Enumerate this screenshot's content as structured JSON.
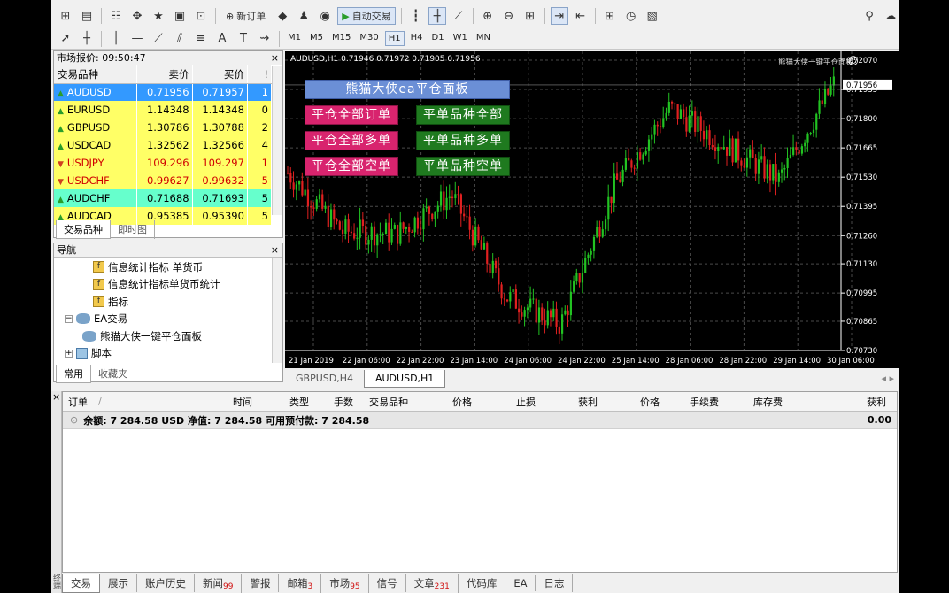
{
  "toolbar": {
    "new_order": "新订单",
    "auto_trading": "自动交易",
    "timeframes": [
      "M1",
      "M5",
      "M15",
      "M30",
      "H1",
      "H4",
      "D1",
      "W1",
      "MN"
    ],
    "active_timeframe": "H1"
  },
  "market_watch": {
    "title": "市场报价: 09:50:47",
    "col_symbol": "交易品种",
    "col_bid": "卖价",
    "col_ask": "买价",
    "col_spread": "!",
    "rows": [
      {
        "symbol": "AUDUSD",
        "bid": "0.71956",
        "ask": "0.71957",
        "spread": "1",
        "bg": "#3399ff",
        "fg": "#ffffff",
        "dir": "up"
      },
      {
        "symbol": "EURUSD",
        "bid": "1.14348",
        "ask": "1.14348",
        "spread": "0",
        "bg": "#ffff66",
        "fg": "#000000",
        "dir": "up"
      },
      {
        "symbol": "GBPUSD",
        "bid": "1.30786",
        "ask": "1.30788",
        "spread": "2",
        "bg": "#ffff66",
        "fg": "#000000",
        "dir": "up"
      },
      {
        "symbol": "USDCAD",
        "bid": "1.32562",
        "ask": "1.32566",
        "spread": "4",
        "bg": "#ffff66",
        "fg": "#000000",
        "dir": "up"
      },
      {
        "symbol": "USDJPY",
        "bid": "109.296",
        "ask": "109.297",
        "spread": "1",
        "bg": "#ffff66",
        "fg": "#d00000",
        "dir": "down"
      },
      {
        "symbol": "USDCHF",
        "bid": "0.99627",
        "ask": "0.99632",
        "spread": "5",
        "bg": "#ffff66",
        "fg": "#d00000",
        "dir": "down"
      },
      {
        "symbol": "AUDCHF",
        "bid": "0.71688",
        "ask": "0.71693",
        "spread": "5",
        "bg": "#66ffcc",
        "fg": "#000000",
        "dir": "up"
      },
      {
        "symbol": "AUDCAD",
        "bid": "0.95385",
        "ask": "0.95390",
        "spread": "5",
        "bg": "#ffff66",
        "fg": "#000000",
        "dir": "up"
      }
    ],
    "tabs": [
      "交易品种",
      "即时图"
    ]
  },
  "navigator": {
    "title": "导航",
    "items": [
      {
        "label": "信息统计指标 单货币",
        "indent": 44,
        "icon": "indicator"
      },
      {
        "label": "信息统计指标单货币统计",
        "indent": 44,
        "icon": "indicator"
      },
      {
        "label": "指标",
        "indent": 44,
        "icon": "indicator"
      },
      {
        "label": "EA交易",
        "indent": 12,
        "icon": "ea",
        "expander": "−"
      },
      {
        "label": "熊猫大侠一键平仓面板",
        "indent": 32,
        "icon": "ea"
      },
      {
        "label": "脚本",
        "indent": 12,
        "icon": "script",
        "expander": "+"
      }
    ],
    "tabs": [
      "常用",
      "收藏夹"
    ]
  },
  "chart": {
    "header": "AUDUSD,H1  0.71946 0.71972 0.71905 0.71956",
    "ea_label": "熊猫大侠一键平仓面板",
    "current_price": "0.71956",
    "price_labels": [
      "0.72070",
      "0.71935",
      "0.71800",
      "0.71665",
      "0.71530",
      "0.71395",
      "0.71260",
      "0.71130",
      "0.70995",
      "0.70865",
      "0.70730"
    ],
    "time_labels": [
      "21 Jan 2019",
      "22 Jan 06:00",
      "22 Jan 22:00",
      "23 Jan 14:00",
      "24 Jan 06:00",
      "24 Jan 22:00",
      "25 Jan 14:00",
      "28 Jan 06:00",
      "28 Jan 22:00",
      "29 Jan 14:00",
      "30 Jan 06:00"
    ],
    "panel_title": "熊猫大侠ea平仓面板",
    "buttons": {
      "close_all": "平仓全部订单",
      "close_buy": "平仓全部多单",
      "close_sell": "平仓全部空单",
      "sym_all": "平单品种全部",
      "sym_buy": "平单品种多单",
      "sym_sell": "平单品种空单"
    },
    "tabs": [
      "GBPUSD,H4",
      "AUDUSD,H1"
    ]
  },
  "terminal": {
    "columns": [
      "订单",
      "时间",
      "类型",
      "手数",
      "交易品种",
      "价格",
      "止损",
      "获利",
      "价格",
      "手续费",
      "库存费",
      "获利"
    ],
    "balance": "余额: 7 284.58 USD  净值: 7 284.58  可用预付款: 7 284.58",
    "profit": "0.00",
    "side_label": "终端",
    "tabs": [
      {
        "label": "交易",
        "badge": ""
      },
      {
        "label": "展示",
        "badge": ""
      },
      {
        "label": "账户历史",
        "badge": ""
      },
      {
        "label": "新闻",
        "badge": "99"
      },
      {
        "label": "警报",
        "badge": ""
      },
      {
        "label": "邮箱",
        "badge": "3"
      },
      {
        "label": "市场",
        "badge": "95"
      },
      {
        "label": "信号",
        "badge": ""
      },
      {
        "label": "文章",
        "badge": "231"
      },
      {
        "label": "代码库",
        "badge": ""
      },
      {
        "label": "EA",
        "badge": ""
      },
      {
        "label": "日志",
        "badge": ""
      }
    ]
  },
  "chart_data": {
    "type": "line",
    "title": "AUDUSD,H1",
    "x": [
      "21 Jan 2019",
      "22 Jan 06:00",
      "22 Jan 22:00",
      "23 Jan 14:00",
      "24 Jan 06:00",
      "24 Jan 22:00",
      "25 Jan 14:00",
      "28 Jan 06:00",
      "28 Jan 22:00",
      "29 Jan 14:00",
      "30 Jan 06:00"
    ],
    "series": [
      {
        "values": [
          0.7155,
          0.7128,
          0.7127,
          0.7145,
          0.7098,
          0.7085,
          0.715,
          0.7185,
          0.7168,
          0.7152,
          0.7196
        ]
      }
    ],
    "ylim": [
      0.7073,
      0.7207
    ]
  }
}
